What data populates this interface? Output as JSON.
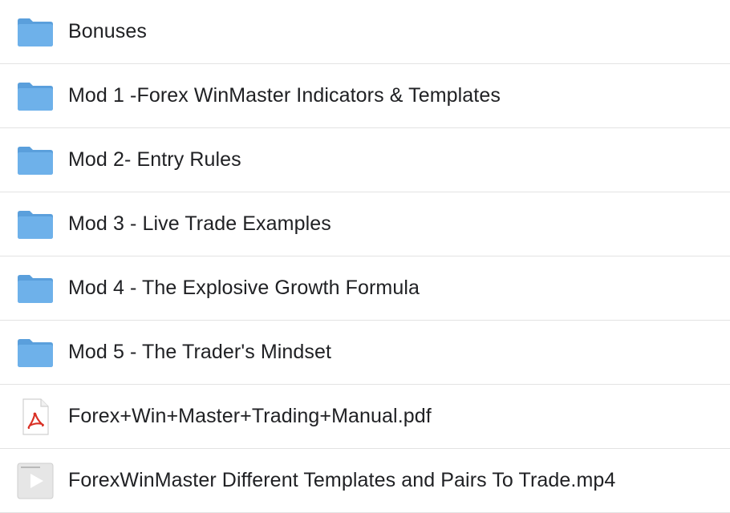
{
  "file_list": {
    "items": [
      {
        "name": "Bonuses",
        "type": "folder",
        "icon": "folder-icon"
      },
      {
        "name": "Mod 1 -Forex WinMaster Indicators & Templates",
        "type": "folder",
        "icon": "folder-icon"
      },
      {
        "name": "Mod 2- Entry Rules",
        "type": "folder",
        "icon": "folder-icon"
      },
      {
        "name": "Mod 3 - Live Trade Examples",
        "type": "folder",
        "icon": "folder-icon"
      },
      {
        "name": "Mod 4 - The Explosive Growth Formula",
        "type": "folder",
        "icon": "folder-icon"
      },
      {
        "name": "Mod 5 - The Trader's Mindset",
        "type": "folder",
        "icon": "folder-icon"
      },
      {
        "name": "Forex+Win+Master+Trading+Manual.pdf",
        "type": "pdf",
        "icon": "pdf-file-icon"
      },
      {
        "name": "ForexWinMaster Different Templates and Pairs To Trade.mp4",
        "type": "video",
        "icon": "video-file-icon"
      }
    ]
  },
  "colors": {
    "folder": "#6aaee8",
    "folder_tab": "#5a9fdc",
    "pdf_red": "#d93025",
    "divider": "#e3e3e3",
    "text": "#202124"
  }
}
